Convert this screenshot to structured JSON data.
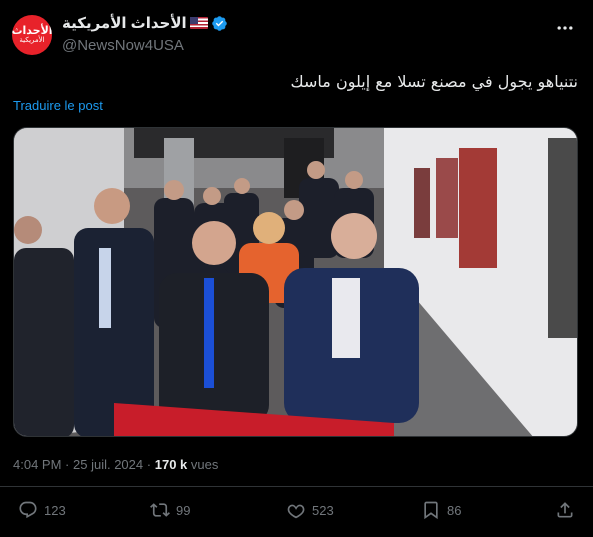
{
  "author": {
    "display_name": "الأحداث الأمريكية",
    "handle": "@NewsNow4USA",
    "avatar_text_main": "الأحداث",
    "avatar_text_sub": "الأمريكية",
    "avatar_color": "#e8222a",
    "verified_color": "#1d9bf0"
  },
  "post": {
    "text": "نتنياهو يجول في مصنع تسلا مع إيلون ماسك",
    "translate_label": "Traduire le post"
  },
  "media": {
    "type": "video-still",
    "content": "video frame in a factory corridor: group of people riding a tour cart past wall posters"
  },
  "meta": {
    "time": "4:04 PM",
    "separator": "·",
    "date": "25 juil. 2024",
    "views_count": "170 k",
    "views_label": "vues"
  },
  "actions": {
    "replies": "123",
    "reposts": "99",
    "likes": "523",
    "bookmarks": "86"
  },
  "colors": {
    "background": "#000000",
    "text_primary": "#e7e9ea",
    "text_secondary": "#71767b",
    "link": "#1d9bf0",
    "border": "#2f3336"
  },
  "icons": [
    "more-icon",
    "verified-badge-icon",
    "reply-icon",
    "repost-icon",
    "like-icon",
    "bookmark-icon",
    "share-icon"
  ]
}
